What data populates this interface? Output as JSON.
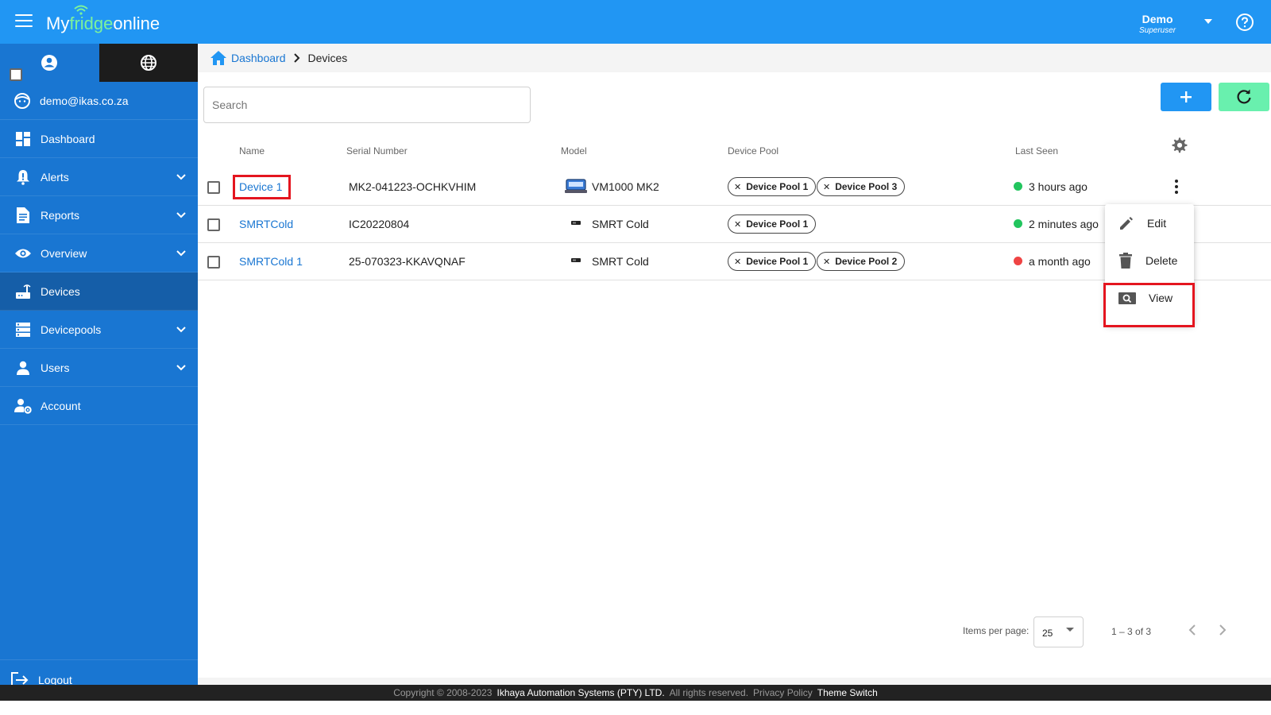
{
  "app": {
    "logo_prefix": "My",
    "logo_mid": "fridge",
    "logo_suffix": "online",
    "user_name": "Demo",
    "user_role": "Superuser"
  },
  "sidebar": {
    "email": "demo@ikas.co.za",
    "items": [
      {
        "label": "Dashboard",
        "icon": "dashboard-icon",
        "expandable": false
      },
      {
        "label": "Alerts",
        "icon": "alert-icon",
        "expandable": true
      },
      {
        "label": "Reports",
        "icon": "report-icon",
        "expandable": true
      },
      {
        "label": "Overview",
        "icon": "eye-icon",
        "expandable": true
      },
      {
        "label": "Devices",
        "icon": "router-icon",
        "expandable": false,
        "active": true
      },
      {
        "label": "Devicepools",
        "icon": "storage-icon",
        "expandable": true
      },
      {
        "label": "Users",
        "icon": "person-icon",
        "expandable": true
      },
      {
        "label": "Account",
        "icon": "account-settings-icon",
        "expandable": false
      }
    ],
    "logout": "Logout"
  },
  "breadcrumb": {
    "home": "Dashboard",
    "current": "Devices"
  },
  "search": {
    "placeholder": "Search"
  },
  "table": {
    "columns": [
      "Name",
      "Serial Number",
      "Model",
      "Device Pool",
      "Last Seen"
    ],
    "rows": [
      {
        "name": "Device 1",
        "serial": "MK2-041223-OCHKVHIM",
        "model": "VM1000 MK2",
        "pools": [
          "Device Pool 1",
          "Device Pool 3"
        ],
        "last_seen": "3 hours ago",
        "status": "online"
      },
      {
        "name": "SMRTCold",
        "serial": "IC20220804",
        "model": "SMRT Cold",
        "pools": [
          "Device Pool 1"
        ],
        "last_seen": "2 minutes ago",
        "status": "online"
      },
      {
        "name": "SMRTCold 1",
        "serial": "25-070323-KKAVQNAF",
        "model": "SMRT Cold",
        "pools": [
          "Device Pool 1",
          "Device Pool 2"
        ],
        "last_seen": "a month ago",
        "status": "offline"
      }
    ]
  },
  "row_menu": {
    "items": [
      "Edit",
      "Delete",
      "View"
    ]
  },
  "paginator": {
    "items_per_page_label": "Items per page:",
    "items_per_page": "25",
    "range": "1 – 3 of 3"
  },
  "footer": {
    "copyright": "Copyright © 2008-2023",
    "company": "Ikhaya Automation Systems (PTY) LTD.",
    "rights": "All rights reserved.",
    "privacy": "Privacy Policy",
    "theme": "Theme Switch"
  },
  "colors": {
    "topbar": "#2196f3",
    "sidebar": "#1976d2",
    "online": "#22c55e",
    "offline": "#ef4444",
    "highlight": "#e4151f",
    "refresh": "#69f0ae"
  }
}
